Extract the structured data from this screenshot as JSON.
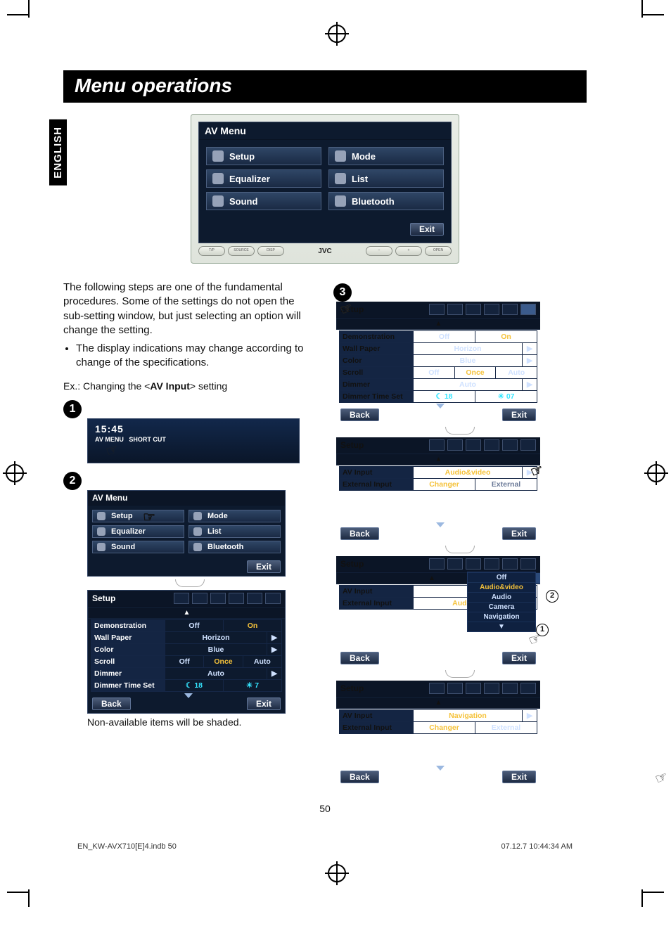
{
  "language_tab": "ENGLISH",
  "heading": "Menu operations",
  "av_menu": {
    "title": "AV Menu",
    "items": [
      {
        "label": "Setup"
      },
      {
        "label": "Mode"
      },
      {
        "label": "Equalizer"
      },
      {
        "label": "List"
      },
      {
        "label": "Sound"
      },
      {
        "label": "Bluetooth"
      }
    ],
    "exit": "Exit",
    "device_brand": "JVC",
    "phys_buttons": [
      "T/P",
      "SOURCE",
      "DISP",
      "−",
      "+",
      "OPEN"
    ]
  },
  "intro": {
    "para": "The following steps are one of the fundamental procedures. Some of the settings do not open the sub-setting window, but just selecting an option will change the setting.",
    "bullet": "The display indications may change according to change of the specifications.",
    "example_prefix": "Ex.: Changing the <",
    "example_bold": "AV Input",
    "example_suffix": "> setting"
  },
  "steps": {
    "clock": {
      "time": "15:45",
      "top_left": "AV MENU",
      "top_right": "SHORT CUT"
    },
    "av_menu_small": {
      "title": "AV Menu",
      "items": [
        "Setup",
        "Mode",
        "Equalizer",
        "List",
        "Sound",
        "Bluetooth"
      ],
      "exit": "Exit"
    },
    "setup_panel": {
      "title": "Setup",
      "rows": [
        {
          "label": "Demonstration",
          "segs": [
            "Off",
            "On"
          ],
          "sel": 1
        },
        {
          "label": "Wall Paper",
          "segs": [
            "Horizon"
          ],
          "arrow": true
        },
        {
          "label": "Color",
          "segs": [
            "Blue"
          ],
          "arrow": true
        },
        {
          "label": "Scroll",
          "segs": [
            "Off",
            "Once",
            "Auto"
          ],
          "sel": 1
        },
        {
          "label": "Dimmer",
          "segs": [
            "Auto"
          ],
          "arrow": true
        },
        {
          "label": "Dimmer Time Set",
          "segs": [
            "☾ 18",
            "☀ 7"
          ]
        }
      ],
      "back": "Back",
      "exit": "Exit"
    },
    "nonavail_caption": "Non-available items will be shaded."
  },
  "right": {
    "panel1": {
      "title": "Setup",
      "rows": [
        {
          "label": "Demonstration",
          "segs": [
            "Off",
            "On"
          ],
          "sel": 1
        },
        {
          "label": "Wall Paper",
          "segs": [
            "Horizon"
          ],
          "arrow": true
        },
        {
          "label": "Color",
          "segs": [
            "Blue"
          ],
          "arrow": true
        },
        {
          "label": "Scroll",
          "segs": [
            "Off",
            "Once",
            "Auto"
          ],
          "sel": 1
        },
        {
          "label": "Dimmer",
          "segs": [
            "Auto"
          ],
          "arrow": true
        },
        {
          "label": "Dimmer Time Set",
          "segs": [
            "☾ 18",
            "☀ 07"
          ]
        }
      ],
      "back": "Back",
      "exit": "Exit"
    },
    "panel2": {
      "title": "Setup",
      "rows": [
        {
          "label": "AV Input",
          "segs": [
            "Audio&video"
          ],
          "sel": 0,
          "arrow": true
        },
        {
          "label": "External Input",
          "segs": [
            "Changer",
            "External"
          ]
        }
      ],
      "back": "Back",
      "exit": "Exit"
    },
    "panel3": {
      "title": "Setup",
      "rows": [
        {
          "label": "AV Input",
          "segs": [
            "Off"
          ]
        },
        {
          "label": "External Input",
          "segs": [
            "Audio&video"
          ],
          "sel": 0
        }
      ],
      "dropdown": [
        "Off",
        "Audio&video",
        "Audio",
        "Camera",
        "Navigation"
      ],
      "dd_sel": 1,
      "back": "Back",
      "exit": "Exit",
      "callout1": "1",
      "callout2": "2"
    },
    "panel4": {
      "title": "Setup",
      "rows": [
        {
          "label": "AV Input",
          "segs": [
            "Navigation"
          ],
          "sel": 0,
          "arrow": true
        },
        {
          "label": "External Input",
          "segs": [
            "Changer",
            "External"
          ]
        }
      ],
      "back": "Back",
      "exit": "Exit"
    }
  },
  "page_number": "50",
  "footer": {
    "file": "EN_KW-AVX710[E]4.indb   50",
    "timestamp": "07.12.7   10:44:34 AM"
  }
}
